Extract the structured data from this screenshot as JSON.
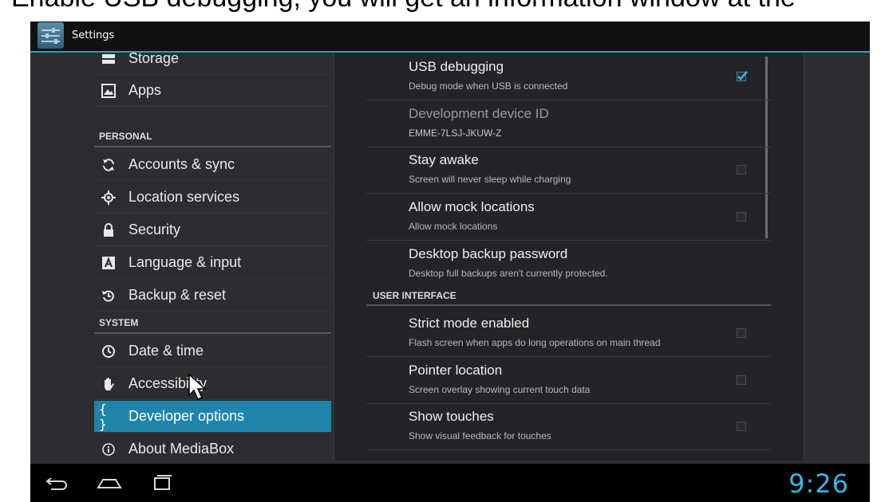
{
  "caption": "Enable USB debugging, you will get an information window at the",
  "app": {
    "title": "Settings"
  },
  "sidebar": {
    "items": [
      {
        "label": "Storage",
        "icon": "storage-icon"
      },
      {
        "label": "Apps",
        "icon": "apps-icon"
      },
      {
        "header": "PERSONAL"
      },
      {
        "label": "Accounts & sync",
        "icon": "sync-icon"
      },
      {
        "label": "Location services",
        "icon": "location-icon"
      },
      {
        "label": "Security",
        "icon": "lock-icon"
      },
      {
        "label": "Language & input",
        "icon": "keyboard-icon"
      },
      {
        "label": "Backup & reset",
        "icon": "backup-icon"
      },
      {
        "header": "SYSTEM"
      },
      {
        "label": "Date & time",
        "icon": "clock-icon"
      },
      {
        "label": "Accessibility",
        "icon": "hand-icon"
      },
      {
        "label": "Developer options",
        "icon": "braces-icon",
        "selected": true
      },
      {
        "label": "About MediaBox",
        "icon": "info-icon"
      }
    ]
  },
  "preferences": [
    {
      "title": "USB debugging",
      "summary": "Debug mode when USB is connected",
      "checked": true,
      "enabled": true
    },
    {
      "title": "Development device ID",
      "summary": "EMME-7LSJ-JKUW-Z",
      "enabled": false,
      "checkbox": false
    },
    {
      "title": "Stay awake",
      "summary": "Screen will never sleep while charging",
      "checked": false,
      "enabled": true
    },
    {
      "title": "Allow mock locations",
      "summary": "Allow mock locations",
      "checked": false,
      "enabled": true
    },
    {
      "title": "Desktop backup password",
      "summary": "Desktop full backups aren't currently protected.",
      "checkbox": false,
      "enabled": true
    },
    {
      "category": "USER INTERFACE"
    },
    {
      "title": "Strict mode enabled",
      "summary": "Flash screen when apps do long operations on main thread",
      "checked": false,
      "enabled": true
    },
    {
      "title": "Pointer location",
      "summary": "Screen overlay showing current touch data",
      "checked": false,
      "enabled": true
    },
    {
      "title": "Show touches",
      "summary": "Show visual feedback for touches",
      "checked": false,
      "enabled": true
    }
  ],
  "navbar": {
    "buttons": [
      "back-icon",
      "home-icon",
      "recent-apps-icon"
    ],
    "clock": "9:26"
  },
  "colors": {
    "accent": "#1e84ab",
    "clock": "#3ab5e4",
    "actionbar_line": "#2f9dc1"
  }
}
